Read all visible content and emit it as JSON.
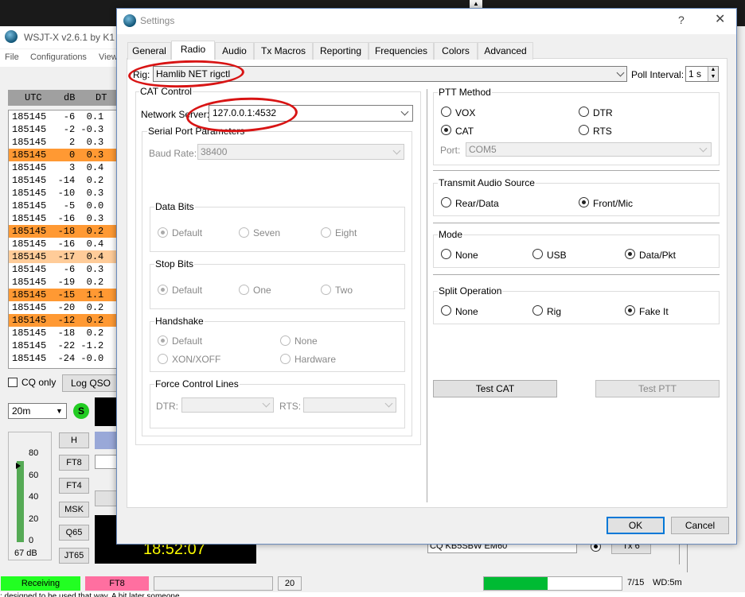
{
  "background_app": {
    "title": "WSJT-X   v2.6.1   by K1",
    "menu": [
      "File",
      "Configurations",
      "View"
    ],
    "table_headers": [
      "UTC",
      "dB",
      "DT"
    ],
    "decodes": [
      {
        "text": "185145   -6  0.1",
        "hl": ""
      },
      {
        "text": "185145   -2 -0.3",
        "hl": ""
      },
      {
        "text": "185145    2  0.3",
        "hl": ""
      },
      {
        "text": "185145    0  0.3",
        "hl": "o"
      },
      {
        "text": "185145    3  0.4",
        "hl": ""
      },
      {
        "text": "185145  -14  0.2",
        "hl": ""
      },
      {
        "text": "185145  -10  0.3",
        "hl": ""
      },
      {
        "text": "185145   -5  0.0",
        "hl": ""
      },
      {
        "text": "185145  -16  0.3",
        "hl": ""
      },
      {
        "text": "185145  -18  0.2",
        "hl": "o"
      },
      {
        "text": "185145  -16  0.4",
        "hl": ""
      },
      {
        "text": "185145  -17  0.4",
        "hl": "l"
      },
      {
        "text": "185145   -6  0.3",
        "hl": ""
      },
      {
        "text": "185145  -19  0.2",
        "hl": ""
      },
      {
        "text": "185145  -15  1.1",
        "hl": "o"
      },
      {
        "text": "185145  -20  0.2",
        "hl": ""
      },
      {
        "text": "185145  -12  0.2",
        "hl": "o"
      },
      {
        "text": "185145  -18  0.2",
        "hl": ""
      },
      {
        "text": "185145  -22 -1.2",
        "hl": ""
      },
      {
        "text": "185145  -24 -0.0",
        "hl": ""
      }
    ],
    "cq_only_label": "CQ only",
    "log_qso_label": "Log QSO",
    "band_value": "20m",
    "s_label": "S",
    "meter_ticks": [
      "80",
      "60",
      "40",
      "20",
      "0"
    ],
    "meter_db": "67 dB",
    "mode_buttons": [
      "H",
      "FT8",
      "FT4",
      "MSK",
      "Q65",
      "JT65"
    ],
    "clock": "18:52:07",
    "status_receiving": "Receiving",
    "status_mode": "FT8",
    "status_num": "20",
    "progress": 0.46,
    "status_period": "7/15",
    "status_wd": "WD:5m",
    "cq_message": "CQ KB5SBW EM60",
    "tx6_label": "Tx 6",
    "bottom_text": "; designed to be used that way. A bit later someone"
  },
  "dialog": {
    "title": "Settings",
    "help_glyph": "?",
    "close_glyph": "✕",
    "tabs": [
      "General",
      "Radio",
      "Audio",
      "Tx Macros",
      "Reporting",
      "Frequencies",
      "Colors",
      "Advanced"
    ],
    "active_tab": "Radio",
    "rig_label": "Rig:",
    "rig_value": "Hamlib NET rigctl",
    "poll_label": "Poll Interval:",
    "poll_value": "1 s",
    "cat_control": {
      "title": "CAT Control",
      "network_server_label": "Network Server:",
      "network_server_value": "127.0.0.1:4532",
      "serial_title": "Serial Port Parameters",
      "baud_label": "Baud Rate:",
      "baud_value": "38400",
      "data_bits_title": "Data Bits",
      "data_bits": [
        "Default",
        "Seven",
        "Eight"
      ],
      "stop_bits_title": "Stop Bits",
      "stop_bits": [
        "Default",
        "One",
        "Two"
      ],
      "handshake_title": "Handshake",
      "handshake": [
        "Default",
        "None",
        "XON/XOFF",
        "Hardware"
      ],
      "force_title": "Force Control Lines",
      "dtr_label": "DTR:",
      "rts_label": "RTS:"
    },
    "ptt": {
      "title": "PTT Method",
      "options": [
        "VOX",
        "DTR",
        "CAT",
        "RTS"
      ],
      "selected": "CAT",
      "port_label": "Port:",
      "port_value": "COM5"
    },
    "audio_source": {
      "title": "Transmit Audio Source",
      "options": [
        "Rear/Data",
        "Front/Mic"
      ],
      "selected": "Front/Mic"
    },
    "mode": {
      "title": "Mode",
      "options": [
        "None",
        "USB",
        "Data/Pkt"
      ],
      "selected": "Data/Pkt"
    },
    "split": {
      "title": "Split Operation",
      "options": [
        "None",
        "Rig",
        "Fake It"
      ],
      "selected": "Fake It"
    },
    "test_cat_label": "Test CAT",
    "test_ptt_label": "Test PTT",
    "ok_label": "OK",
    "cancel_label": "Cancel"
  },
  "colors": {
    "annotation": "#d81414",
    "decode_highlight": "#ff9933",
    "receiving": "#22ff22",
    "mode_status": "#ff6fa0"
  }
}
